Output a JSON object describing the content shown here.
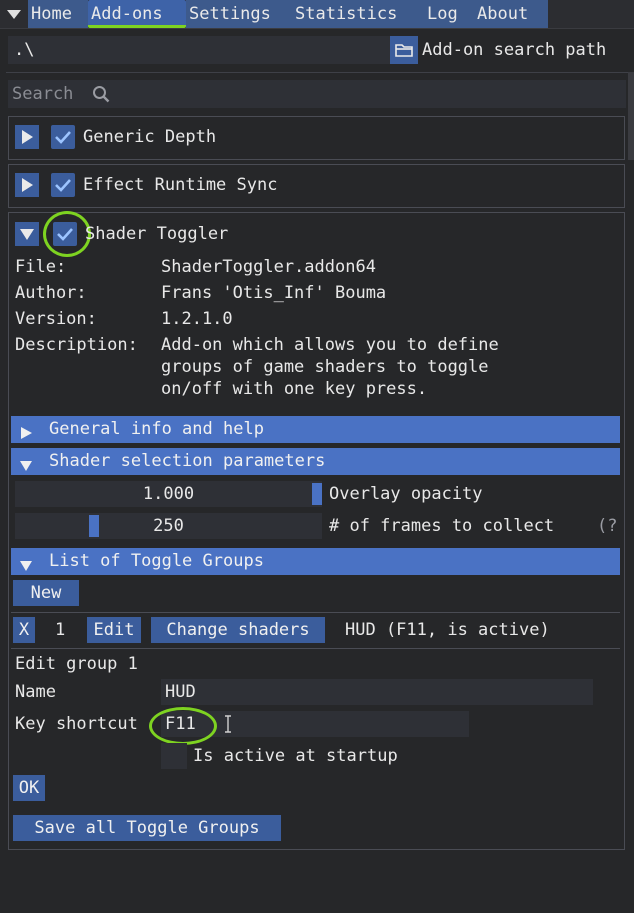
{
  "menu": {
    "items": [
      {
        "label": "Home"
      },
      {
        "label": "Add-ons"
      },
      {
        "label": "Settings"
      },
      {
        "label": "Statistics"
      },
      {
        "label": "Log"
      },
      {
        "label": "About"
      }
    ]
  },
  "search_path": {
    "value": ".\\",
    "button_label": "Add-on search path"
  },
  "search": {
    "placeholder": "Search"
  },
  "addons": {
    "generic_depth": "Generic Depth",
    "effect_runtime_sync": "Effect Runtime Sync",
    "shader_toggler": "Shader Toggler"
  },
  "details": {
    "file_label": "File:",
    "file_value": "ShaderToggler.addon64",
    "author_label": "Author:",
    "author_value": "Frans 'Otis_Inf' Bouma",
    "version_label": "Version:",
    "version_value": "1.2.1.0",
    "description_label": "Description:",
    "description_line1": "Add-on which allows you to define",
    "description_line2": "groups of game shaders to toggle",
    "description_line3": "on/off with one key press."
  },
  "sections": {
    "general_info": "General info and help",
    "shader_selection": "Shader selection parameters",
    "toggle_groups": "List of Toggle Groups"
  },
  "params": {
    "overlay_value": "1.000",
    "overlay_fraction": 1.0,
    "overlay_label": "Overlay opacity",
    "frames_value": "250",
    "frames_label": "# of frames to collect",
    "frames_help": "(?"
  },
  "groups": {
    "new_label": "New",
    "remove_label": "X",
    "group_index": "1",
    "edit_label": "Edit",
    "change_shaders_label": "Change shaders",
    "group_summary": "HUD (F11, is active)"
  },
  "edit_group": {
    "title": "Edit group 1",
    "name_label": "Name",
    "name_value": "HUD",
    "key_label": "Key shortcut",
    "key_value": "F11",
    "active_label": "Is active at startup",
    "ok_label": "OK"
  },
  "save_all_label": "Save all Toggle Groups",
  "colors": {
    "background": "#262729",
    "button": "#3b5d9c",
    "header": "#4a72c4",
    "highlight": "#7ed321"
  }
}
